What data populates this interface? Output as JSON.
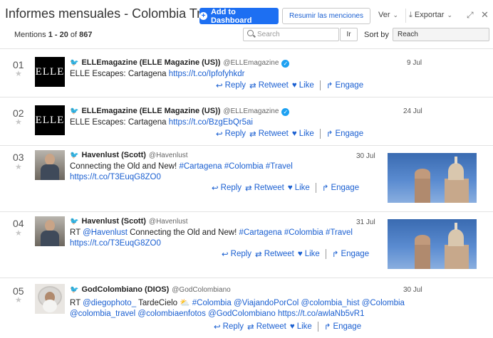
{
  "header": {
    "title": "Informes mensuales - Colombia Trav...",
    "add_button": "Add to Dashboard",
    "summary_button": "Resumir las menciones",
    "view_label": "Ver",
    "export_label": "Exportar"
  },
  "toolbar": {
    "count_prefix": "Mentions ",
    "count_range": "1 - 20",
    "count_of": " of ",
    "count_total": "867",
    "search_placeholder": "Search",
    "go_label": "Ir",
    "sort_label": "Sort by",
    "sort_value": "Reach"
  },
  "actions": {
    "reply": "Reply",
    "retweet": "Retweet",
    "like": "Like",
    "engage": "Engage"
  },
  "mentions": [
    {
      "num": "01",
      "name": "ELLEmagazine (ELLE Magazine (US))",
      "handle": "@ELLEmagazine",
      "date": "9 Jul",
      "avatar_text": "ELLE",
      "text": "ELLE Escapes: Cartagena ",
      "link": "https://t.co/Ipfofyhkdr"
    },
    {
      "num": "02",
      "name": "ELLEmagazine (ELLE Magazine (US))",
      "handle": "@ELLEmagazine",
      "date": "24 Jul",
      "avatar_text": "ELLE",
      "text": "ELLE Escapes: Cartagena ",
      "link": "https://t.co/BzgEbQr5ai"
    },
    {
      "num": "03",
      "name": "Havenlust (Scott)",
      "handle": "@Havenlust",
      "date": "30 Jul",
      "text": "Connecting the Old and New! ",
      "tags": "#Cartagena #Colombia #Travel",
      "link": "https://t.co/T3EuqG8ZO0"
    },
    {
      "num": "04",
      "name": "Havenlust (Scott)",
      "handle": "@Havenlust",
      "date": "31 Jul",
      "text_rt": "RT ",
      "rt_handle": "@Havenlust",
      "text": " Connecting the Old and New! ",
      "tags": "#Cartagena #Colombia #Travel",
      "link": "https://t.co/T3EuqG8ZO0"
    },
    {
      "num": "05",
      "name": "GodColombiano (DIOS)",
      "handle": "@GodColombiano",
      "date": "30 Jul",
      "text_rt": "RT ",
      "rt_handle": "@diegophoto_",
      "text": " TardeCielo ⛅ ",
      "line1_links": "#Colombia @ViajandoPorCol @colombia_hist @Colombia",
      "line2_links": "@colombia_travel @colombiaenfotos @GodColombiano",
      "link": "https://t.co/awlaNb5vR1"
    }
  ]
}
